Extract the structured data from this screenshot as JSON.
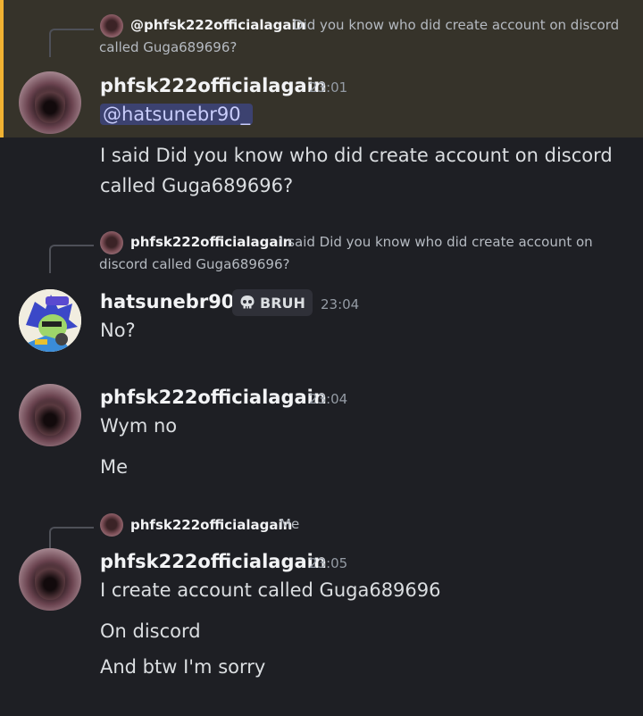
{
  "messages": [
    {
      "reply": {
        "name": "@phfsk222officialagain",
        "text_line1": "Did you know who did create account on discord",
        "text_line2": "called Guga689696?"
      },
      "author": "phfsk222officialagain",
      "time": "23:01",
      "mention": "@hatsunebr90_",
      "lines": [
        "I said Did you know who did create account on discord",
        "called Guga689696?"
      ]
    },
    {
      "reply": {
        "name": "phfsk222officialagain",
        "text_line1": "I said Did you know who did create account on",
        "text_line2": "discord called Guga689696?"
      },
      "author": "hatsunebr90_",
      "tag": {
        "icon": "skull-icon",
        "label": "BRUH"
      },
      "time": "23:04",
      "lines": [
        "No?"
      ]
    },
    {
      "author": "phfsk222officialagain",
      "time": "23:04",
      "lines": [
        "Wym no",
        "Me"
      ]
    },
    {
      "reply": {
        "name": "phfsk222officialagain",
        "text_line1": "Me"
      },
      "author": "phfsk222officialagain",
      "time": "23:05",
      "lines": [
        "I create account called Guga689696",
        "On discord",
        "And btw I'm sorry"
      ]
    }
  ],
  "colors": {
    "highlight_bar": "#f0b232",
    "highlight_bg": "#36332a",
    "background": "#1e1f24",
    "mention_bg": "#3c4270"
  }
}
